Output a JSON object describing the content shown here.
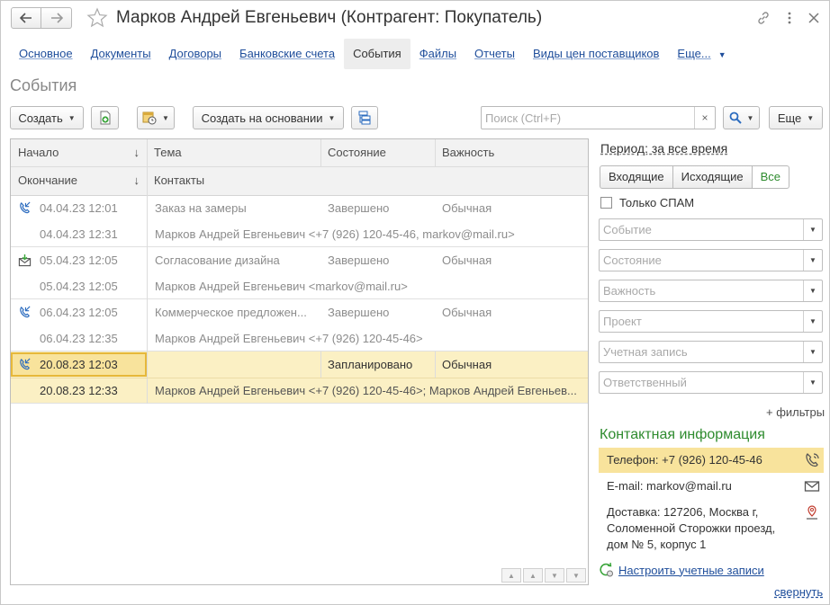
{
  "window": {
    "title": "Марков Андрей Евгеньевич (Контрагент: Покупатель)"
  },
  "tabs": [
    {
      "label": "Основное",
      "active": false
    },
    {
      "label": "Документы",
      "active": false
    },
    {
      "label": "Договоры",
      "active": false
    },
    {
      "label": "Банковские счета",
      "active": false
    },
    {
      "label": "События",
      "active": true
    },
    {
      "label": "Файлы",
      "active": false
    },
    {
      "label": "Отчеты",
      "active": false
    },
    {
      "label": "Виды цен поставщиков",
      "active": false
    },
    {
      "label": "Еще...",
      "active": false
    }
  ],
  "section_title": "События",
  "toolbar": {
    "create_label": "Создать",
    "create_based_label": "Создать на основании",
    "search_placeholder": "Поиск (Ctrl+F)",
    "search_clear": "×",
    "more_label": "Еще"
  },
  "table": {
    "headers": {
      "start": "Начало",
      "end": "Окончание",
      "subject": "Тема",
      "contacts": "Контакты",
      "state": "Состояние",
      "importance": "Важность",
      "sort_arrow": "↓"
    },
    "rows": [
      {
        "icon": "phone-call-icon",
        "start": "04.04.23 12:01",
        "end": "04.04.23 12:31",
        "subject": "Заказ на замеры",
        "state": "Завершено",
        "importance": "Обычная",
        "contacts": "Марков Андрей Евгеньевич <+7 (926) 120-45-46, markov@mail.ru>",
        "selected": false
      },
      {
        "icon": "email-incoming-icon",
        "start": "05.04.23 12:05",
        "end": "05.04.23 12:05",
        "subject": "Согласование дизайна",
        "state": "Завершено",
        "importance": "Обычная",
        "contacts": "Марков Андрей Евгеньевич <markov@mail.ru>",
        "selected": false
      },
      {
        "icon": "phone-call-icon",
        "start": "06.04.23 12:05",
        "end": "06.04.23 12:35",
        "subject": "Коммерческое предложен...",
        "state": "Завершено",
        "importance": "Обычная",
        "contacts": "Марков Андрей Евгеньевич <+7 (926) 120-45-46>",
        "selected": false
      },
      {
        "icon": "phone-call-icon",
        "start": "20.08.23 12:03",
        "end": "20.08.23 12:33",
        "subject": "",
        "state": "Запланировано",
        "importance": "Обычная",
        "contacts": "Марков Андрей Евгеньевич <+7 (926) 120-45-46>; Марков Андрей Евгеньев...",
        "selected": true
      }
    ]
  },
  "filters": {
    "period": "Период: за все время",
    "direction_options": [
      "Входящие",
      "Исходящие",
      "Все"
    ],
    "direction_selected": "Все",
    "spam_label": "Только СПАМ",
    "spam_checked": false,
    "selects": [
      "Событие",
      "Состояние",
      "Важность",
      "Проект",
      "Учетная запись",
      "Ответственный"
    ],
    "more_filters": "+ фильтры"
  },
  "contact_info": {
    "title": "Контактная информация",
    "phone": "Телефон: +7 (926) 120-45-46",
    "email": "E-mail: markov@mail.ru",
    "address_lines": [
      "Доставка: 127206, Москва г,",
      "Соломенной Сторожки проезд,",
      "дом № 5, корпус 1"
    ]
  },
  "setup_accounts": "Настроить учетные записи",
  "collapse": "свернуть",
  "colors": {
    "link": "#1f4e9b",
    "accent_green": "#2e8b2e",
    "selection": "#fbf0c4",
    "highlight": "#f8e39c"
  }
}
